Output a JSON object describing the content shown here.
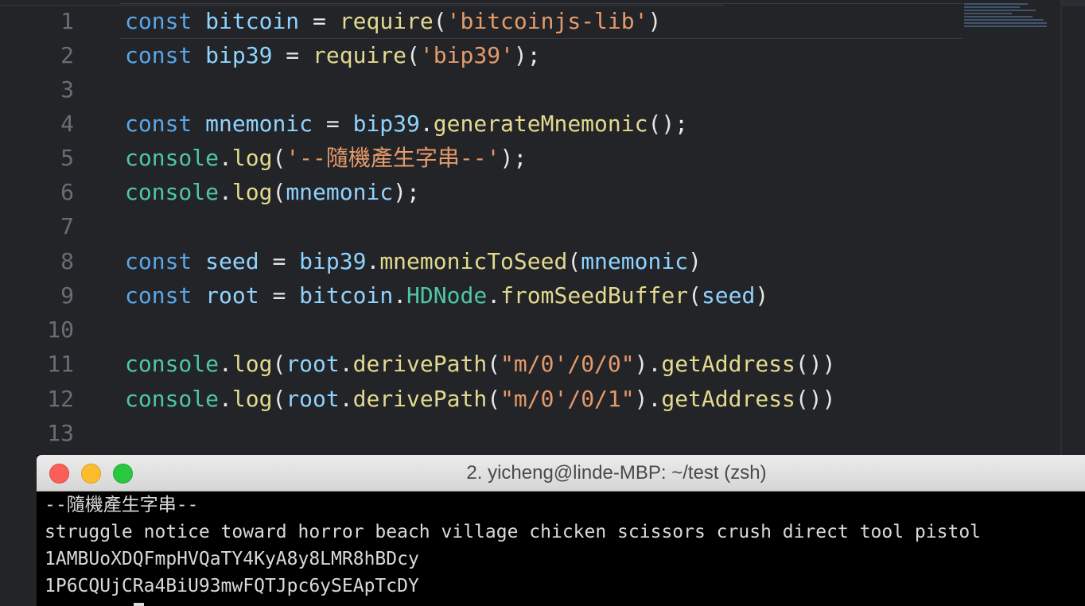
{
  "editor": {
    "lines": [
      {
        "n": "1",
        "tokens": [
          [
            "kw",
            "const"
          ],
          [
            "op",
            " "
          ],
          [
            "id",
            "bitcoin"
          ],
          [
            "op",
            " = "
          ],
          [
            "fn",
            "require"
          ],
          [
            "op",
            "("
          ],
          [
            "str",
            "'bitcoinjs-lib'"
          ],
          [
            "op",
            ")"
          ]
        ]
      },
      {
        "n": "2",
        "tokens": [
          [
            "kw",
            "const"
          ],
          [
            "op",
            " "
          ],
          [
            "id",
            "bip39"
          ],
          [
            "op",
            " = "
          ],
          [
            "fn",
            "require"
          ],
          [
            "op",
            "("
          ],
          [
            "str",
            "'bip39'"
          ],
          [
            "op",
            ");"
          ]
        ]
      },
      {
        "n": "3",
        "tokens": []
      },
      {
        "n": "4",
        "tokens": [
          [
            "kw",
            "const"
          ],
          [
            "op",
            " "
          ],
          [
            "id",
            "mnemonic"
          ],
          [
            "op",
            " = "
          ],
          [
            "id",
            "bip39"
          ],
          [
            "op",
            "."
          ],
          [
            "fn",
            "generateMnemonic"
          ],
          [
            "op",
            "();"
          ]
        ]
      },
      {
        "n": "5",
        "tokens": [
          [
            "obj",
            "console"
          ],
          [
            "op",
            "."
          ],
          [
            "fn",
            "log"
          ],
          [
            "op",
            "("
          ],
          [
            "str",
            "'--隨機產生字串--'"
          ],
          [
            "op",
            ");"
          ]
        ]
      },
      {
        "n": "6",
        "tokens": [
          [
            "obj",
            "console"
          ],
          [
            "op",
            "."
          ],
          [
            "fn",
            "log"
          ],
          [
            "op",
            "("
          ],
          [
            "id",
            "mnemonic"
          ],
          [
            "op",
            ");"
          ]
        ]
      },
      {
        "n": "7",
        "tokens": []
      },
      {
        "n": "8",
        "tokens": [
          [
            "kw",
            "const"
          ],
          [
            "op",
            " "
          ],
          [
            "id",
            "seed"
          ],
          [
            "op",
            " = "
          ],
          [
            "id",
            "bip39"
          ],
          [
            "op",
            "."
          ],
          [
            "fn",
            "mnemonicToSeed"
          ],
          [
            "op",
            "("
          ],
          [
            "id",
            "mnemonic"
          ],
          [
            "op",
            ")"
          ]
        ]
      },
      {
        "n": "9",
        "tokens": [
          [
            "kw",
            "const"
          ],
          [
            "op",
            " "
          ],
          [
            "id",
            "root"
          ],
          [
            "op",
            " = "
          ],
          [
            "id",
            "bitcoin"
          ],
          [
            "op",
            "."
          ],
          [
            "obj",
            "HDNode"
          ],
          [
            "op",
            "."
          ],
          [
            "fn",
            "fromSeedBuffer"
          ],
          [
            "op",
            "("
          ],
          [
            "id",
            "seed"
          ],
          [
            "op",
            ")"
          ]
        ]
      },
      {
        "n": "10",
        "tokens": []
      },
      {
        "n": "11",
        "tokens": [
          [
            "obj",
            "console"
          ],
          [
            "op",
            "."
          ],
          [
            "fn",
            "log"
          ],
          [
            "op",
            "("
          ],
          [
            "id",
            "root"
          ],
          [
            "op",
            "."
          ],
          [
            "fn",
            "derivePath"
          ],
          [
            "op",
            "("
          ],
          [
            "str",
            "\"m/0'/0/0\""
          ],
          [
            "op",
            ")."
          ],
          [
            "fn",
            "getAddress"
          ],
          [
            "op",
            "())"
          ]
        ]
      },
      {
        "n": "12",
        "tokens": [
          [
            "obj",
            "console"
          ],
          [
            "op",
            "."
          ],
          [
            "fn",
            "log"
          ],
          [
            "op",
            "("
          ],
          [
            "id",
            "root"
          ],
          [
            "op",
            "."
          ],
          [
            "fn",
            "derivePath"
          ],
          [
            "op",
            "("
          ],
          [
            "str",
            "\"m/0'/0/1\""
          ],
          [
            "op",
            ")."
          ],
          [
            "fn",
            "getAddress"
          ],
          [
            "op",
            "())"
          ]
        ]
      },
      {
        "n": "13",
        "tokens": []
      }
    ]
  },
  "terminal": {
    "title": "2. yicheng@linde-MBP: ~/test (zsh)",
    "output": [
      "--隨機產生字串--",
      "struggle notice toward horror beach village chicken scissors crush direct tool pistol",
      "1AMBUoXDQFmpHVQaTY4KyA8y8LMR8hBDcy",
      "1P6CQUjCRa4BiU93mwFQTJpc6ySEApTcDY"
    ]
  },
  "colors": {
    "keyword": "#5aa6e6",
    "identifier": "#8fd3ff",
    "function": "#e3d98f",
    "string": "#e49a6b",
    "object": "#4ec6a8",
    "close_button": "#fc5f57",
    "minimize_button": "#fdbc2e",
    "zoom_button": "#28c840"
  }
}
